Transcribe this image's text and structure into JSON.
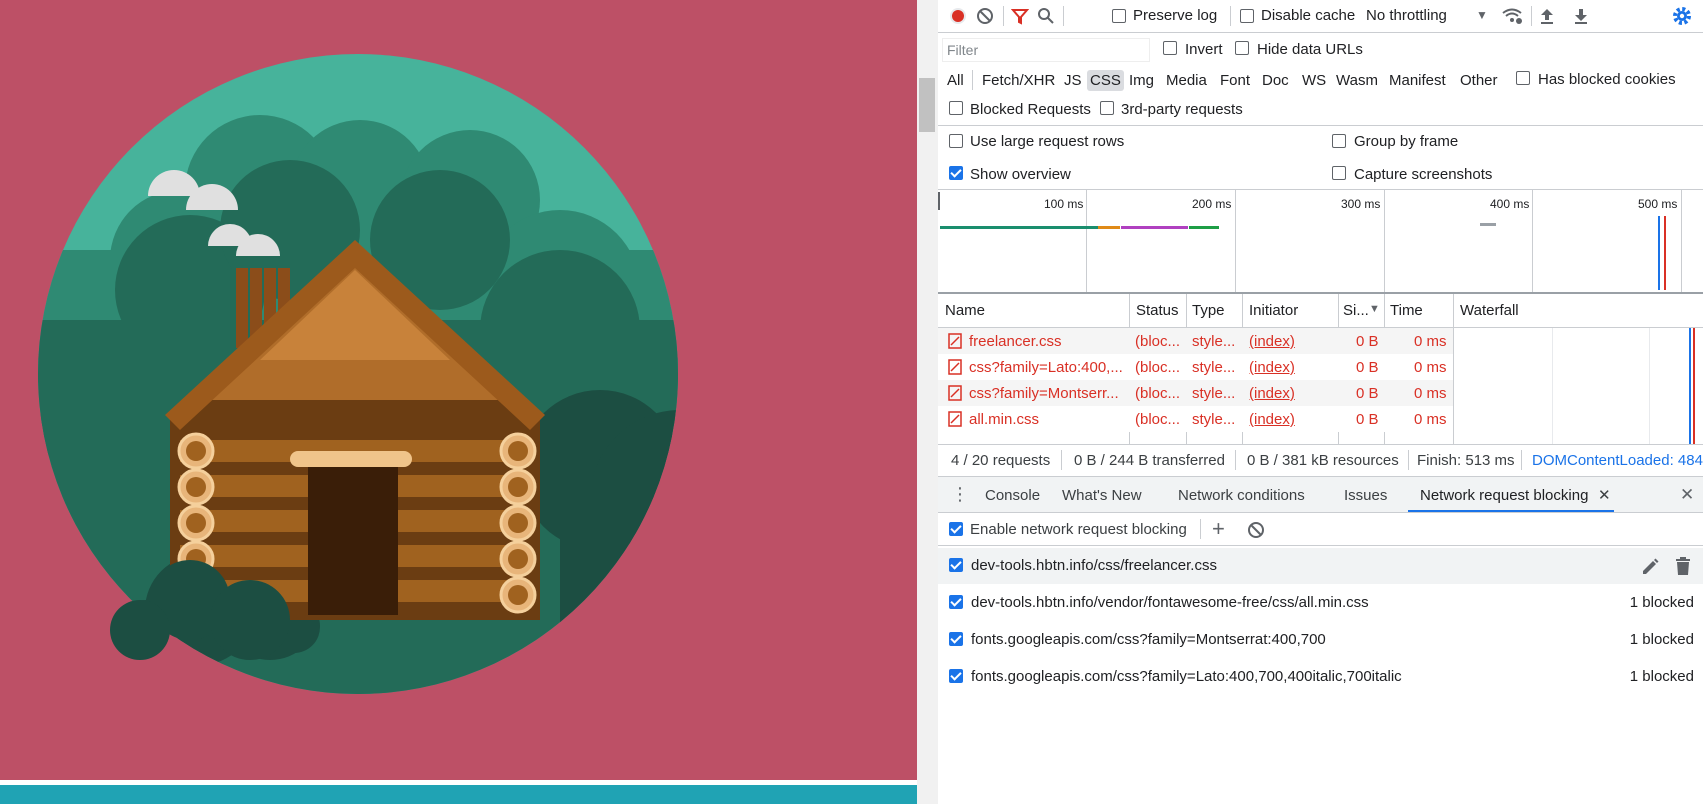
{
  "toolbar": {
    "preserve_log": "Preserve log",
    "disable_cache": "Disable cache",
    "throttling": "No throttling"
  },
  "filter": {
    "placeholder": "Filter",
    "invert": "Invert",
    "hide_data_urls": "Hide data URLs"
  },
  "type_filters": [
    "All",
    "Fetch/XHR",
    "JS",
    "CSS",
    "Img",
    "Media",
    "Font",
    "Doc",
    "WS",
    "Wasm",
    "Manifest",
    "Other"
  ],
  "has_blocked_cookies": "Has blocked cookies",
  "blocked_requests": "Blocked Requests",
  "third_party": "3rd-party requests",
  "options": {
    "large_rows": "Use large request rows",
    "group_by_frame": "Group by frame",
    "show_overview": "Show overview",
    "capture_screenshots": "Capture screenshots"
  },
  "overview": {
    "ticks": [
      "100 ms",
      "200 ms",
      "300 ms",
      "400 ms",
      "500 ms"
    ]
  },
  "table": {
    "headers": [
      "Name",
      "Status",
      "Type",
      "Initiator",
      "Si...",
      "Time",
      "Waterfall"
    ],
    "rows": [
      {
        "name": "freelancer.css",
        "status": "(bloc...",
        "type": "style...",
        "initiator": "(index)",
        "size": "0 B",
        "time": "0 ms"
      },
      {
        "name": "css?family=Lato:400,...",
        "status": "(bloc...",
        "type": "style...",
        "initiator": "(index)",
        "size": "0 B",
        "time": "0 ms"
      },
      {
        "name": "css?family=Montserr...",
        "status": "(bloc...",
        "type": "style...",
        "initiator": "(index)",
        "size": "0 B",
        "time": "0 ms"
      },
      {
        "name": "all.min.css",
        "status": "(bloc...",
        "type": "style...",
        "initiator": "(index)",
        "size": "0 B",
        "time": "0 ms"
      }
    ]
  },
  "status": {
    "requests": "4 / 20 requests",
    "transferred": "0 B / 244 B transferred",
    "resources": "0 B / 381 kB resources",
    "finish": "Finish: 513 ms",
    "dcl": "DOMContentLoaded: 484"
  },
  "drawer": {
    "tabs": [
      "Console",
      "What's New",
      "Network conditions",
      "Issues",
      "Network request blocking"
    ],
    "enable_label": "Enable network request blocking",
    "rules": [
      {
        "pattern": "dev-tools.hbtn.info/css/freelancer.css",
        "count": ""
      },
      {
        "pattern": "dev-tools.hbtn.info/vendor/fontawesome-free/css/all.min.css",
        "count": "1 blocked"
      },
      {
        "pattern": "fonts.googleapis.com/css?family=Montserrat:400,700",
        "count": "1 blocked"
      },
      {
        "pattern": "fonts.googleapis.com/css?family=Lato:400,700,400italic,700italic",
        "count": "1 blocked"
      }
    ]
  },
  "colors": {
    "accent": "#1a73e8",
    "record": "#d93025",
    "page_bg": "#bd5066",
    "circle": "#47b39b",
    "teal_strip": "#20a3b4"
  },
  "icons": [
    "record-icon",
    "clear-icon",
    "filter-icon",
    "search-icon",
    "online-icon",
    "upload-icon",
    "download-icon",
    "settings-icon",
    "edit-icon",
    "delete-icon",
    "add-icon",
    "block-icon",
    "close-icon",
    "more-icon"
  ]
}
